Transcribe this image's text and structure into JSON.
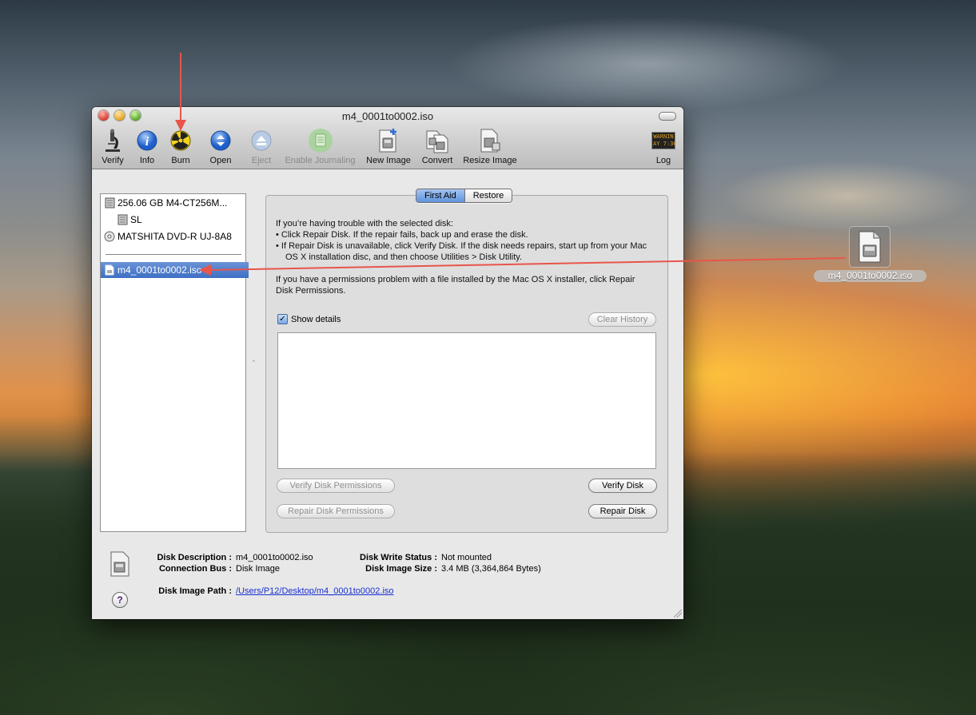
{
  "window": {
    "title": "m4_0001to0002.iso"
  },
  "toolbar": {
    "items": [
      {
        "label": "Verify",
        "icon": "microscope-icon"
      },
      {
        "label": "Info",
        "icon": "info-icon"
      },
      {
        "label": "Burn",
        "icon": "burn-icon"
      },
      {
        "label": "Open",
        "icon": "open-icon"
      },
      {
        "label": "Eject",
        "icon": "eject-icon"
      },
      {
        "label": "Enable Journaling",
        "icon": "journaling-icon"
      },
      {
        "label": "New Image",
        "icon": "new-image-icon"
      },
      {
        "label": "Convert",
        "icon": "convert-icon"
      },
      {
        "label": "Resize Image",
        "icon": "resize-image-icon"
      },
      {
        "label": "Log",
        "icon": "log-icon"
      }
    ],
    "log_icon_text": "WARNIN\nAY 7:36"
  },
  "sidebar": {
    "items": [
      {
        "label": "256.06 GB M4-CT256M..."
      },
      {
        "label": "SL"
      },
      {
        "label": "MATSHITA DVD-R UJ-8A8"
      },
      {
        "label": "m4_0001to0002.iso",
        "selected": true
      }
    ]
  },
  "tabs": [
    {
      "label": "First Aid",
      "active": true
    },
    {
      "label": "Restore",
      "active": false
    }
  ],
  "first_aid": {
    "intro": "If you’re having trouble with the selected disk:",
    "bullet1": "•  Click Repair Disk. If the repair fails, back up and erase the disk.",
    "bullet2": "•  If Repair Disk is unavailable, click Verify Disk. If the disk needs repairs, start up from your Mac OS X installation disc, and then choose Utilities > Disk Utility.",
    "permissions": "If you have a permissions problem with a file installed by the Mac OS X installer, click Repair Disk Permissions.",
    "show_details": "Show details",
    "clear_history": "Clear History",
    "verify_permissions": "Verify Disk Permissions",
    "verify_disk": "Verify Disk",
    "repair_permissions": "Repair Disk Permissions",
    "repair_disk": "Repair Disk"
  },
  "info": {
    "disk_description_label": "Disk Description :",
    "disk_description": "m4_0001to0002.iso",
    "connection_bus_label": "Connection Bus :",
    "connection_bus": "Disk Image",
    "write_status_label": "Disk Write Status :",
    "write_status": "Not mounted",
    "image_size_label": "Disk Image Size :",
    "image_size": "3.4 MB (3,364,864 Bytes)",
    "image_path_label": "Disk Image Path :",
    "image_path": "/Users/P12/Desktop/m4_0001to0002.iso",
    "help": "?"
  },
  "desktop": {
    "file_label": "m4_0001to0002.iso"
  },
  "annotation_color": "#e8554a"
}
